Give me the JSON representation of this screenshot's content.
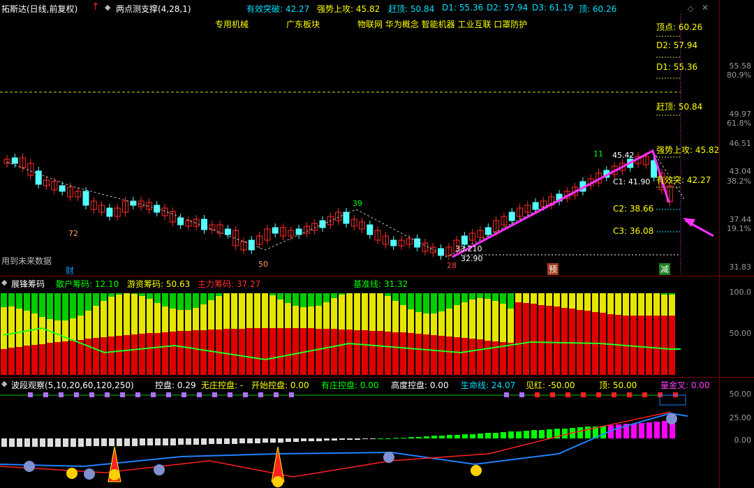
{
  "header": {
    "stock": "拓斯达(日线,前复权)",
    "indicator": "两点测支撑(4,28,1)",
    "levels": [
      {
        "label": "有效突破: 42.27",
        "color": "#00e0ff"
      },
      {
        "label": "强势上攻: 45.82",
        "color": "#ffff00"
      },
      {
        "label": "赶顶: 50.84",
        "color": "#00e0ff"
      },
      {
        "label": "D1: 55.36",
        "color": "#00e0ff"
      },
      {
        "label": "D2: 57.94",
        "color": "#00e0ff"
      },
      {
        "label": "D3: 61.19",
        "color": "#00e0ff"
      },
      {
        "label": "顶: 60.26",
        "color": "#00e0ff"
      }
    ],
    "concepts": [
      "专用机械",
      "广东板块",
      "物联网 华为概念 智能机器 工业互联 口罩防护"
    ]
  },
  "main_chart": {
    "right_labels": [
      {
        "label": "顶点: 60.26"
      },
      {
        "label": "D2: 57.94"
      },
      {
        "label": "D1: 55.36"
      },
      {
        "label": "赶顶: 50.84"
      },
      {
        "label": "强势上攻: 45.82"
      },
      {
        "label": "有效突: 42.27"
      },
      {
        "label": "C2: 38.66"
      },
      {
        "label": "C3: 36.08"
      }
    ],
    "axis": [
      "55.58",
      "80.9%",
      "49.97",
      "61.8%",
      "46.51",
      "43.04",
      "38.2%",
      "37.44",
      "19.1%",
      "31.83"
    ],
    "annotations": {
      "n72": "72",
      "n50": "50",
      "n39": "39",
      "n11": "11",
      "p4542": "45.42",
      "c1": "C1: 41.90",
      "p33210": "33.210",
      "p3290": "32.90",
      "p28": "28",
      "cai": "财",
      "yu": "预",
      "jian": "减",
      "future": "用到未来数据"
    }
  },
  "chips_panel": {
    "title": "展锋筹码",
    "retail": "散户筹码: 12.10",
    "hot": "游资筹码: 50.63",
    "main": "主力筹码: 37.27",
    "base": "基准线: 31.32",
    "axis": [
      "100.0",
      "50.00"
    ]
  },
  "wave_panel": {
    "title": "波段观察(5,10,20,60,120,250)",
    "control": "控盘: 0.29",
    "no_dealer": "无庄控盘: -",
    "start": "开始控盘: 0.00",
    "has_dealer": "有庄控盘: 0.00",
    "high": "高度控盘: 0.00",
    "life": "生命线: 24.07",
    "red": "见红: -50.00",
    "top": "顶: 50.00",
    "cross": "量金叉: 0.00",
    "axis": [
      "50.00",
      "25.00",
      "0.00"
    ]
  },
  "colors": {
    "up": "#ff2a2a",
    "down": "#54ffff",
    "support": "#ff30ff",
    "retail_bar": "#00cc00",
    "hot_bar": "#e6e600",
    "main_bar": "#e00000"
  },
  "icons": [
    "red-arrow-up-icon",
    "diamond-icon",
    "smiley-icon",
    "sad-face-icon"
  ]
}
